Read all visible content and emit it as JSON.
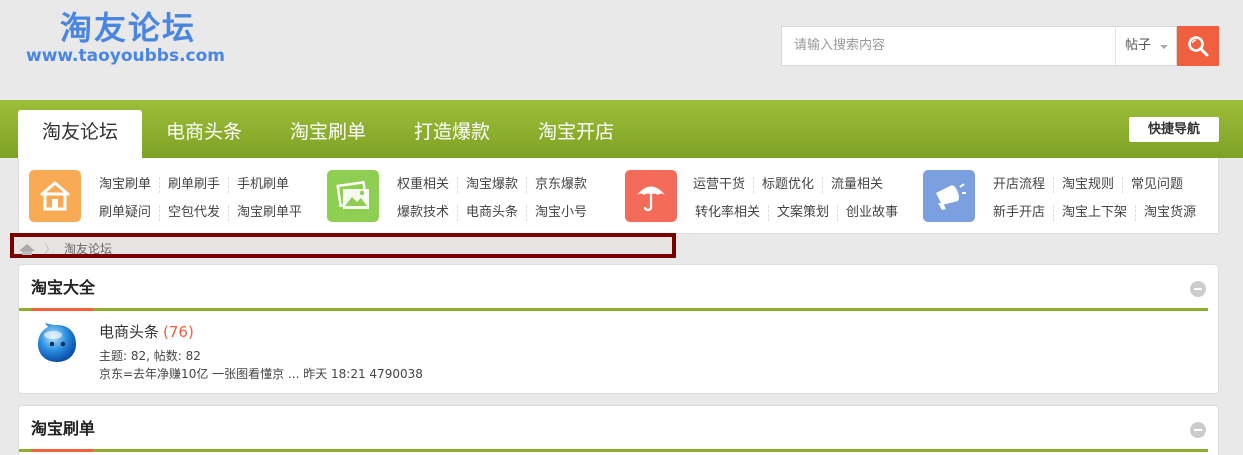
{
  "logo": {
    "title": "淘友论坛",
    "url_text": "www.taoyoubbs.com"
  },
  "search": {
    "placeholder": "请输入搜索内容",
    "type_value": "帖子"
  },
  "nav": {
    "tabs": [
      "淘友论坛",
      "电商头条",
      "淘宝刷单",
      "打造爆款",
      "淘宝开店"
    ],
    "active_index": 0,
    "quick_nav": "快捷导航"
  },
  "submenu": {
    "groups": [
      {
        "icon": "home-icon",
        "color": "#f8ab54",
        "rows": [
          [
            "淘宝刷单",
            "刷单刷手",
            "手机刷单"
          ],
          [
            "刷单疑问",
            "空包代发",
            "淘宝刷单平"
          ]
        ]
      },
      {
        "icon": "picture-icon",
        "color": "#8ecf53",
        "rows": [
          [
            "权重相关",
            "淘宝爆款",
            "京东爆款"
          ],
          [
            "爆款技术",
            "电商头条",
            "淘宝小号"
          ]
        ]
      },
      {
        "icon": "umbrella-icon",
        "color": "#f56b5a",
        "rows": [
          [
            "运营干货",
            "标题优化",
            "流量相关"
          ],
          [
            "转化率相关",
            "文案策划",
            "创业故事"
          ]
        ]
      },
      {
        "icon": "megaphone-icon",
        "color": "#7c9fe0",
        "rows": [
          [
            "开店流程",
            "淘宝规则",
            "常见问题"
          ],
          [
            "新手开店",
            "淘宝上下架",
            "淘宝货源"
          ]
        ]
      }
    ]
  },
  "breadcrumb": {
    "current": "淘友论坛"
  },
  "panels": [
    {
      "title": "淘宝大全",
      "forums": [
        {
          "name": "电商头条",
          "count": "(76)",
          "meta": "主题: 82, 帖数: 82",
          "last": "京东=去年净赚10亿 一张图看懂京 ... 昨天 18:21 4790038"
        }
      ]
    },
    {
      "title": "淘宝刷单",
      "forums": []
    }
  ],
  "colors": {
    "accent": "#f0603f",
    "nav_green": "#8eae2e",
    "brand_blue": "#4a86e0"
  }
}
